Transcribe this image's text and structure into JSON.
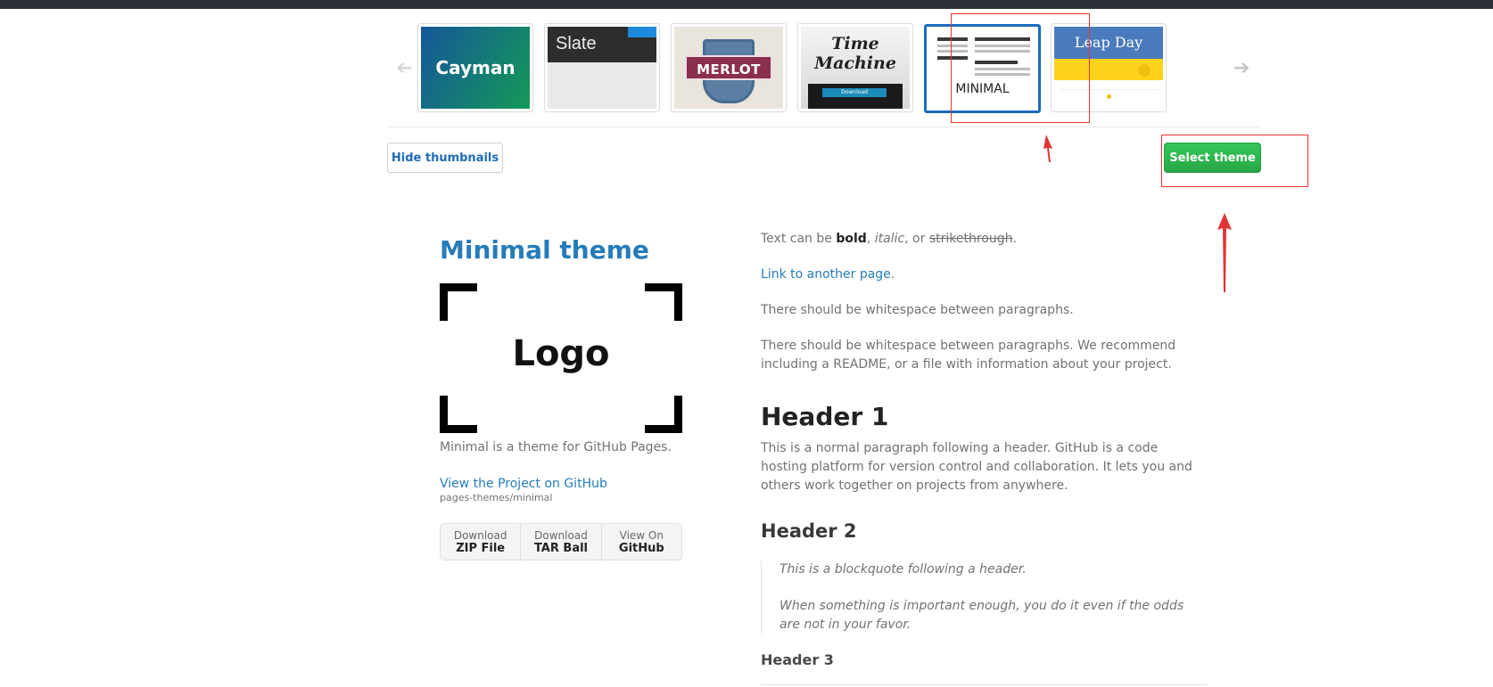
{
  "topbar": {
    "color": "#2b3137"
  },
  "carousel": {
    "prev_icon": "arrow-left-icon",
    "next_icon": "arrow-right-icon",
    "themes": [
      {
        "name": "Cayman",
        "thumb_text": "Cayman"
      },
      {
        "name": "Slate",
        "thumb_text": "Slate"
      },
      {
        "name": "Merlot",
        "thumb_text": "MERLOT"
      },
      {
        "name": "Time Machine",
        "thumb_text_1": "Time",
        "thumb_text_2": "Machine",
        "thumb_button": "Download"
      },
      {
        "name": "Minimal",
        "thumb_text": "MINIMAL",
        "selected": true
      },
      {
        "name": "Leap Day",
        "thumb_text": "Leap Day"
      }
    ]
  },
  "actions": {
    "hide_thumbnails": "Hide thumbnails",
    "select_theme": "Select theme"
  },
  "preview": {
    "title": "Minimal theme",
    "logo_text": "Logo",
    "description": "Minimal is a theme for GitHub Pages.",
    "project_link": "View the Project on GitHub",
    "repo": "pages-themes/minimal",
    "downloads": [
      {
        "small": "Download",
        "big": "ZIP File"
      },
      {
        "small": "Download",
        "big": "TAR Ball"
      },
      {
        "small": "View On",
        "big": "GitHub"
      }
    ],
    "content": {
      "text_prefix": "Text can be ",
      "bold": "bold",
      "sep1": ", ",
      "italic": "italic",
      "sep2": ", or ",
      "strike": "strikethrough",
      "end": ".",
      "link": "Link to another page",
      "link_end": ".",
      "p1": "There should be whitespace between paragraphs.",
      "p2": "There should be whitespace between paragraphs. We recommend including a README, or a file with information about your project.",
      "h1": "Header 1",
      "p3": "This is a normal paragraph following a header. GitHub is a code hosting platform for version control and collaboration. It lets you and others work together on projects from anywhere.",
      "h2": "Header 2",
      "bq1": "This is a blockquote following a header.",
      "bq2": "When something is important enough, you do it even if the odds are not in your favor.",
      "h3": "Header 3"
    }
  },
  "colors": {
    "accent_link": "#267CB9",
    "select_green": "#2ea44f",
    "annotation_red": "#e33333",
    "selected_border": "#1a6bbf"
  }
}
